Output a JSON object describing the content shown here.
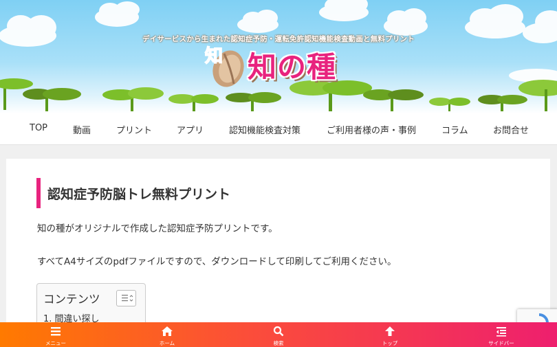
{
  "header": {
    "tagline": "デイサービスから生まれた認知症予防・運転免許認知機能検査動画と無料プリント",
    "logo_text": "知の種",
    "logo_mark_text": "知"
  },
  "nav": {
    "items": [
      {
        "label": "TOP"
      },
      {
        "label": "動画"
      },
      {
        "label": "プリント"
      },
      {
        "label": "アプリ"
      },
      {
        "label": "認知機能検査対策"
      },
      {
        "label": "ご利用者様の声・事例"
      },
      {
        "label": "コラム"
      },
      {
        "label": "お問合せ"
      }
    ]
  },
  "main": {
    "title": "認知症予防脳トレ無料プリント",
    "paragraph_1": "知の種がオリジナルで作成した認知症予防プリントです。",
    "paragraph_2": "すべてA4サイズのpdfファイルですので、ダウンロードして印刷してご利用ください。",
    "toc": {
      "title": "コンテンツ",
      "items": [
        "1. 間違い探し"
      ]
    }
  },
  "bottom_bar": {
    "items": [
      {
        "label": "メニュー",
        "icon": "menu-icon"
      },
      {
        "label": "ホーム",
        "icon": "home-icon"
      },
      {
        "label": "検索",
        "icon": "search-icon"
      },
      {
        "label": "トップ",
        "icon": "arrow-up-icon"
      },
      {
        "label": "サイドバー",
        "icon": "sidebar-icon"
      }
    ]
  },
  "colors": {
    "accent": "#e8237e",
    "bottom_bar_start": "#ff7a00",
    "bottom_bar_end": "#ee1f6e",
    "sky": "#7fd0f4",
    "sprout": "#7cbf2a"
  }
}
